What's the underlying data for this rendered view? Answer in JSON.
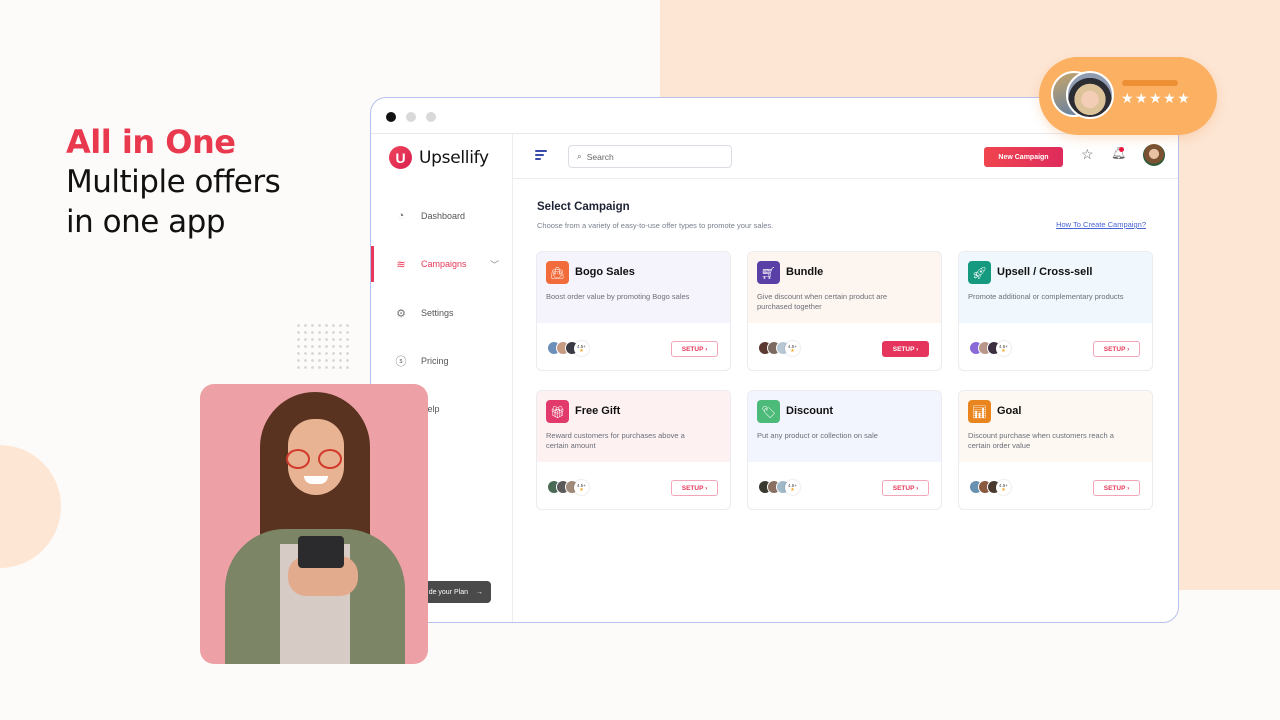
{
  "headline": {
    "accent": "All in One",
    "line1": "Multiple offers",
    "line2": "in one app"
  },
  "review_badge": {
    "stars": "★★★★★",
    "rating_count": 5
  },
  "app": {
    "name": "Upsellify",
    "logo_letter": "U",
    "sidebar": {
      "items": [
        {
          "label": "Dashboard",
          "icon": "dashboard-icon"
        },
        {
          "label": "Campaigns",
          "icon": "layers-icon",
          "active": true,
          "has_submenu": true
        },
        {
          "label": "Settings",
          "icon": "gear-icon"
        },
        {
          "label": "Pricing",
          "icon": "dollar-icon"
        },
        {
          "label": "Help",
          "icon": "help-icon"
        }
      ],
      "upgrade_label": "Upgrade your Plan",
      "upgrade_visible": "de your Plan"
    },
    "topbar": {
      "search_placeholder": "Search",
      "new_campaign_label": "New Campaign"
    },
    "main": {
      "title": "Select Campaign",
      "subtitle": "Choose from a variety of easy-to-use offer types to promote your sales.",
      "help_link": "How To Create Campaign?",
      "cards": [
        {
          "title": "Bogo Sales",
          "desc": "Boost order value by promoting Bogo sales",
          "icon": "shopping-bag-icon",
          "icon_color": "#f26b3a",
          "bg": "#f5f4fd",
          "rating": "4.5+",
          "setup_label": "SETUP ›",
          "setup_filled": false
        },
        {
          "title": "Bundle",
          "desc": "Give discount when certain product are purchased together",
          "icon": "cart-icon",
          "icon_color": "#5a3fa6",
          "bg": "#fdf5ef",
          "rating": "4.5+",
          "setup_label": "SETUP ›",
          "setup_filled": true
        },
        {
          "title": "Upsell / Cross-sell",
          "desc": "Promote additional or complementary products",
          "icon": "rocket-icon",
          "icon_color": "#159a80",
          "bg": "#f1f8fd",
          "rating": "4.5+",
          "setup_label": "SETUP ›",
          "setup_filled": false
        },
        {
          "title": "Free Gift",
          "desc": "Reward customers for purchases above a certain amount",
          "icon": "gift-icon",
          "icon_color": "#e23a6a",
          "bg": "#fdf1f1",
          "rating": "4.5+",
          "setup_label": "SETUP ›",
          "setup_filled": false
        },
        {
          "title": "Discount",
          "desc": "Put any product or collection on sale",
          "icon": "tag-icon",
          "icon_color": "#4cba78",
          "bg": "#f2f5fd",
          "rating": "4.5+",
          "setup_label": "SETUP ›",
          "setup_filled": false
        },
        {
          "title": "Goal",
          "desc": "Discount purchase when customers reach a certain order value",
          "icon": "bar-chart-icon",
          "icon_color": "#e9851f",
          "bg": "#fdf8f2",
          "rating": "4.5+",
          "setup_label": "SETUP ›",
          "setup_filled": false
        }
      ]
    }
  }
}
